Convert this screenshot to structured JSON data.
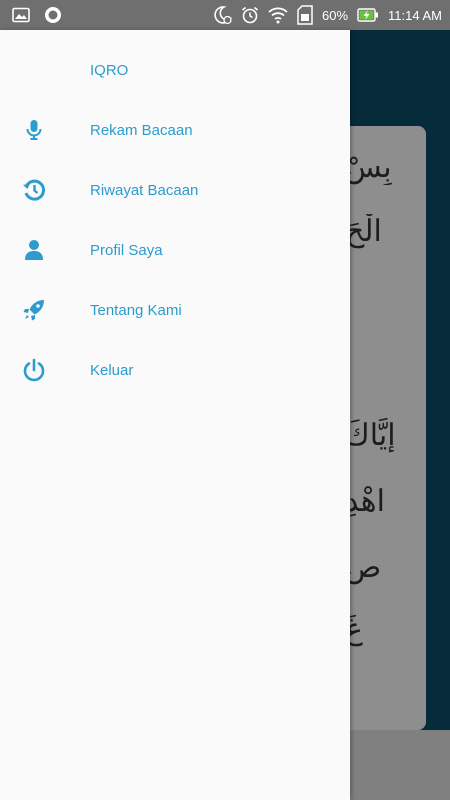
{
  "status_bar": {
    "battery_percent": "60%",
    "time": "11:14 AM",
    "left_icons": [
      "image-icon",
      "record-circle-icon"
    ],
    "right_icons": [
      "moon-clock-icon",
      "alarm-clock-icon",
      "wifi-icon",
      "sd-card-icon",
      "battery-charging-icon"
    ]
  },
  "drawer": {
    "title": "IQRO",
    "items": [
      {
        "label": "Rekam Bacaan",
        "icon": "microphone-icon"
      },
      {
        "label": "Riwayat Bacaan",
        "icon": "history-icon"
      },
      {
        "label": "Profil Saya",
        "icon": "user-icon"
      },
      {
        "label": "Tentang Kami",
        "icon": "rocket-icon"
      },
      {
        "label": "Keluar",
        "icon": "power-icon"
      }
    ]
  },
  "background_page": {
    "verse_lines": [
      "بِسْ",
      "الْحَ",
      "إِيَّاكَ",
      "اهْدِ",
      "صِ",
      "غَ"
    ]
  },
  "colors": {
    "accent": "#2d9ccd",
    "header": "#0b4a66",
    "status_bar": "#6f6f6f",
    "drawer_bg": "#fafafa"
  }
}
